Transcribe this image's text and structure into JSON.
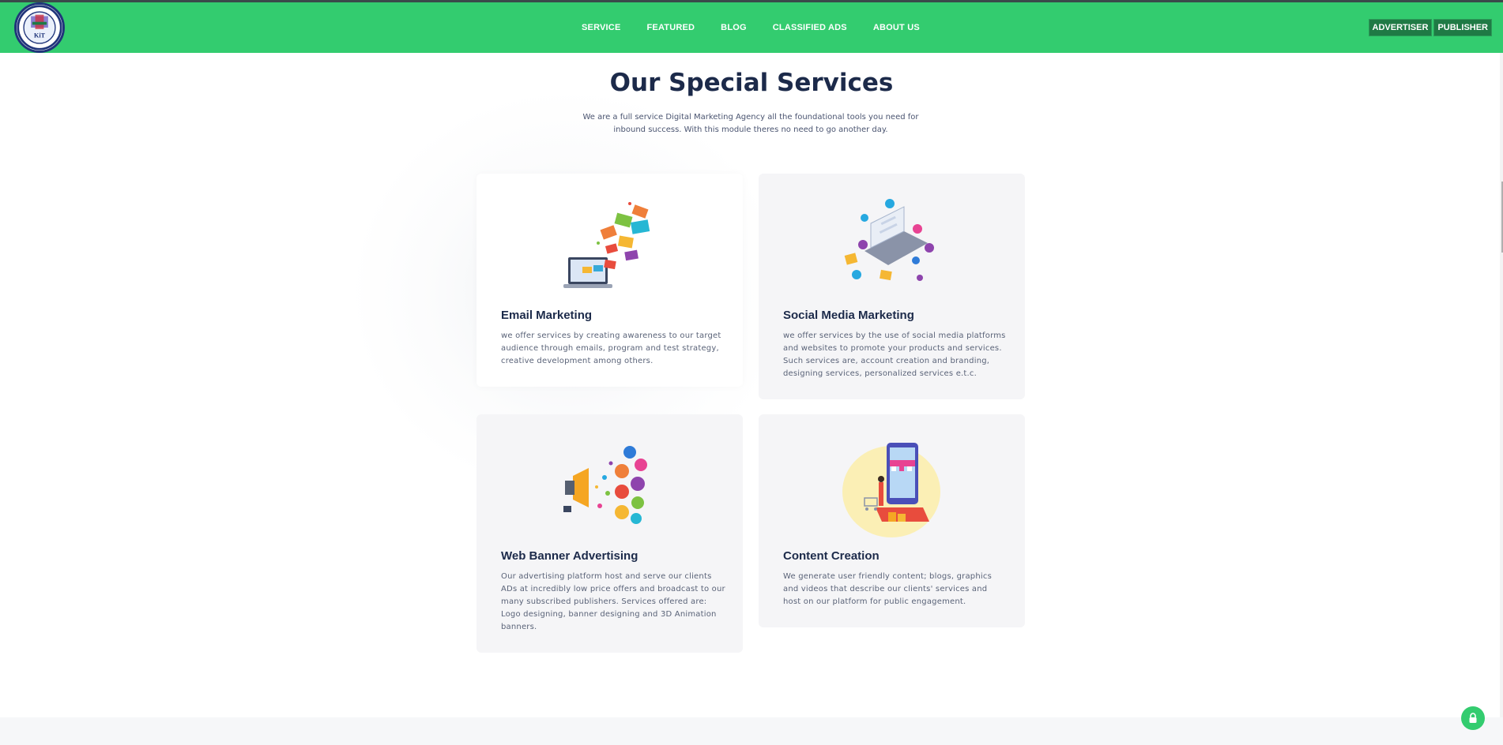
{
  "nav": {
    "logo_alt": "KIT",
    "links": [
      "SERVICE",
      "FEATURED",
      "BLOG",
      "CLASSIFIED ADS",
      "ABOUT US"
    ],
    "advertiser_label": "ADVERTISER",
    "publisher_label": "PUBLISHER"
  },
  "colors": {
    "accent": "#33cc6f",
    "title": "#1c2a4a",
    "card_alt": "#f5f5f7"
  },
  "section": {
    "title": "Our Special Services",
    "subtitle": "We are a full service Digital Marketing Agency all the foundational tools you need for inbound success. With this module theres no need to go another day."
  },
  "cards": [
    {
      "title": "Email Marketing",
      "text": "we offer services by creating awareness to our target audience through emails, program and test strategy, creative development among others.",
      "icon": "email-illustration"
    },
    {
      "title": "Social Media Marketing",
      "text": "we offer services by the use of social media platforms and websites to promote your products and services. Such services are, account creation and branding, designing services, personalized services e.t.c.",
      "icon": "social-media-illustration"
    },
    {
      "title": "Web Banner Advertising",
      "text": "Our advertising platform host and serve our clients ADs at incredibly low price offers and broadcast to our many subscribed publishers. Services offered are: Logo designing, banner designing and 3D Animation banners.",
      "icon": "megaphone-illustration"
    },
    {
      "title": "Content Creation",
      "text": "We generate user friendly content; blogs, graphics and videos that describe our clients' services and host on our platform for public engagement.",
      "icon": "content-creation-illustration"
    }
  ],
  "floating": {
    "icon": "lock-icon"
  }
}
